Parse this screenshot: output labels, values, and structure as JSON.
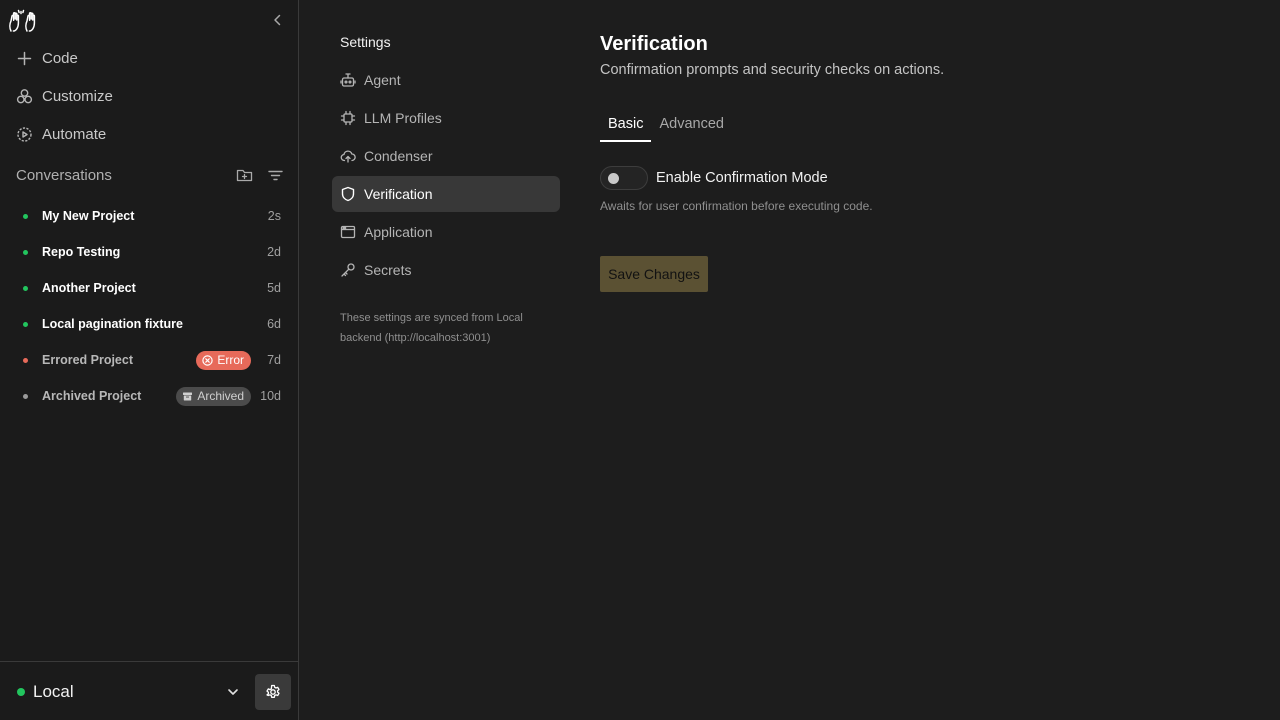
{
  "sidebar": {
    "nav": [
      {
        "label": "Code",
        "icon": "plus-icon"
      },
      {
        "label": "Customize",
        "icon": "grid-icon"
      },
      {
        "label": "Automate",
        "icon": "automate-icon"
      }
    ],
    "conversations_title": "Conversations",
    "conversations": [
      {
        "title": "My New Project",
        "time": "2s",
        "status": "running",
        "status_color": "#22c55e"
      },
      {
        "title": "Repo Testing",
        "time": "2d",
        "status": "running",
        "status_color": "#22c55e"
      },
      {
        "title": "Another Project",
        "time": "5d",
        "status": "running",
        "status_color": "#22c55e"
      },
      {
        "title": "Local pagination fixture",
        "time": "6d",
        "status": "running",
        "status_color": "#22c55e"
      },
      {
        "title": "Errored Project",
        "time": "7d",
        "status": "error",
        "status_color": "#e76a5a",
        "badge": "Error"
      },
      {
        "title": "Archived Project",
        "time": "10d",
        "status": "archived",
        "status_color": "#9a9a9a",
        "badge": "Archived"
      }
    ],
    "backend": {
      "label": "Local",
      "status_color": "#22c55e"
    }
  },
  "settings_nav": {
    "heading": "Settings",
    "items": [
      {
        "label": "Agent",
        "icon": "robot-icon"
      },
      {
        "label": "LLM Profiles",
        "icon": "chip-icon"
      },
      {
        "label": "Condenser",
        "icon": "cloud-upload-icon"
      },
      {
        "label": "Verification",
        "icon": "shield-icon",
        "active": true
      },
      {
        "label": "Application",
        "icon": "window-icon"
      },
      {
        "label": "Secrets",
        "icon": "key-icon"
      }
    ],
    "sync_note": "These settings are synced from Local backend (http://localhost:3001)"
  },
  "main": {
    "title": "Verification",
    "subtitle": "Confirmation prompts and security checks on actions.",
    "tabs": [
      {
        "label": "Basic",
        "active": true
      },
      {
        "label": "Advanced",
        "active": false
      }
    ],
    "confirmation_toggle": {
      "label": "Enable Confirmation Mode",
      "enabled": false,
      "help": "Awaits for user confirmation before executing code."
    },
    "save_label": "Save Changes"
  },
  "colors": {
    "accent_disabled": "#5b5133",
    "active_nav_bg": "#383838"
  }
}
